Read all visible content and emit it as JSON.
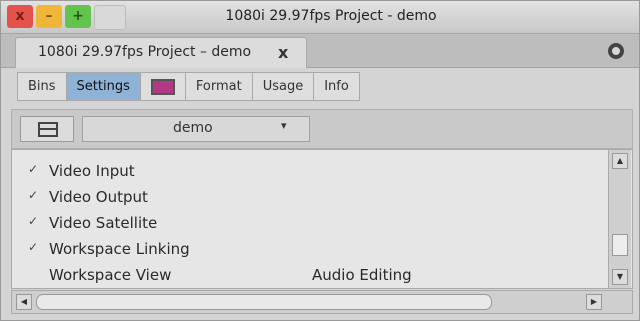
{
  "window": {
    "title": "1080i 29.97fps Project - demo",
    "controls": {
      "close": "x",
      "minimize": "–",
      "maximize": "+"
    }
  },
  "project_tab": {
    "label": "1080i 29.97fps Project – demo",
    "close": "x"
  },
  "tabs": [
    {
      "label": "Bins"
    },
    {
      "label": "Settings"
    },
    {
      "label": "",
      "icon": "color-chip-icon"
    },
    {
      "label": "Format"
    },
    {
      "label": "Usage"
    },
    {
      "label": "Info"
    }
  ],
  "toolbar": {
    "select_value": "demo",
    "select_arrow": "▾"
  },
  "settings_list": [
    {
      "check": "✓",
      "name": "Video Input",
      "value": ""
    },
    {
      "check": "✓",
      "name": "Video Output",
      "value": ""
    },
    {
      "check": "✓",
      "name": "Video Satellite",
      "value": ""
    },
    {
      "check": "✓",
      "name": "Workspace Linking",
      "value": ""
    },
    {
      "check": "",
      "name": "Workspace View",
      "value": "Audio Editing"
    }
  ],
  "scroll": {
    "up": "▲",
    "down": "▼",
    "left": "◀",
    "right": "▶"
  },
  "colors": {
    "active_tab": "#8fb3d6",
    "close_btn": "#e3534b",
    "min_btn": "#f0b63a",
    "max_btn": "#62c44d",
    "chip": "#b13a86"
  }
}
